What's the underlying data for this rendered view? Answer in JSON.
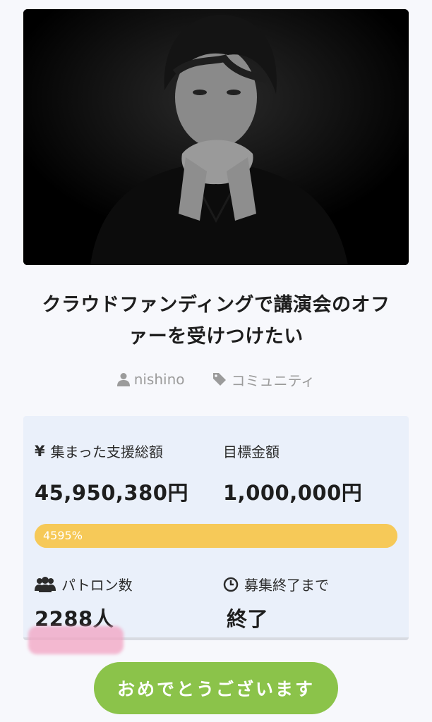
{
  "project": {
    "title_line1": "クラウドファンディングで講演会のオフ",
    "title_line2": "ァーを受けつけたい",
    "author": "nishino",
    "category": "コミュニティ"
  },
  "stats": {
    "raised_label": "集まった支援総額",
    "raised_value": "45,950,380円",
    "goal_label": "目標金額",
    "goal_value": "1,000,000円",
    "progress_text": "4595%",
    "progress_fraction": 1.0,
    "patrons_label": "パトロン数",
    "patrons_value": "2288人",
    "deadline_label": "募集終了まで",
    "deadline_value": "終了"
  },
  "cta": {
    "label": "おめでとうございます"
  },
  "colors": {
    "accent_green": "#8bc34a",
    "progress_yellow": "#f6c958",
    "card_bg": "#eaf0fa",
    "highlight_pink": "#f2a3c2"
  },
  "icons": [
    "user-icon",
    "tag-icon",
    "yen-icon",
    "users-icon",
    "clock-icon"
  ]
}
